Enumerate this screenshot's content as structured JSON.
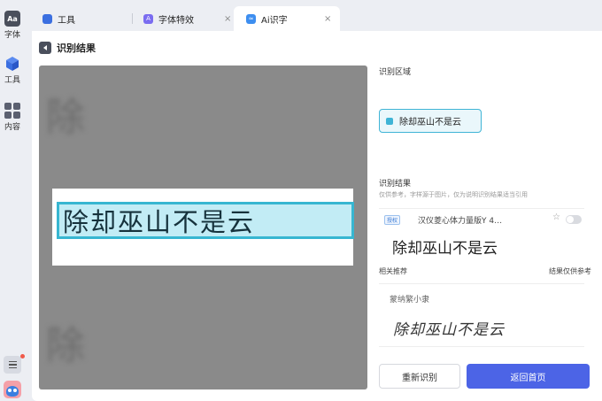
{
  "rail": {
    "items": [
      {
        "label": "字体",
        "icon": "font-aa-icon",
        "badge": "Aa"
      },
      {
        "label": "工具",
        "icon": "cube-icon"
      },
      {
        "label": "内容",
        "icon": "grid-icon"
      }
    ]
  },
  "tabs": [
    {
      "label": "工具",
      "icon": "cube-icon"
    },
    {
      "label": "字体特效",
      "icon": "effects-icon"
    },
    {
      "label": "Ai识字",
      "icon": "ai-icon",
      "active": true,
      "close": "×"
    }
  ],
  "header": {
    "title": "识别结果"
  },
  "image": {
    "recognized_text": "除却巫山不是云",
    "ghost_top": "除           是",
    "ghost_bottom": "除           是"
  },
  "right": {
    "area_label": "识别区域",
    "area_chip": "除却巫山不是云",
    "result_label": "识别结果",
    "result_note": "仅供参考，字样源于图片，仅为说明识别结果适当引用",
    "result": {
      "badge": "授权",
      "font_name": "汉仪菱心体力量版Y 4…",
      "preview": "除却巫山不是云"
    },
    "rec_title": "相关推荐",
    "rec_note": "结果仅供参考",
    "rec": {
      "font_name": "蒙纳繁小隶",
      "preview": "除却巫山不是云"
    },
    "btn_retry": "重新识别",
    "btn_home": "返回首页"
  },
  "colors": {
    "accent": "#4c64e6",
    "highlight": "#37b6d1"
  }
}
